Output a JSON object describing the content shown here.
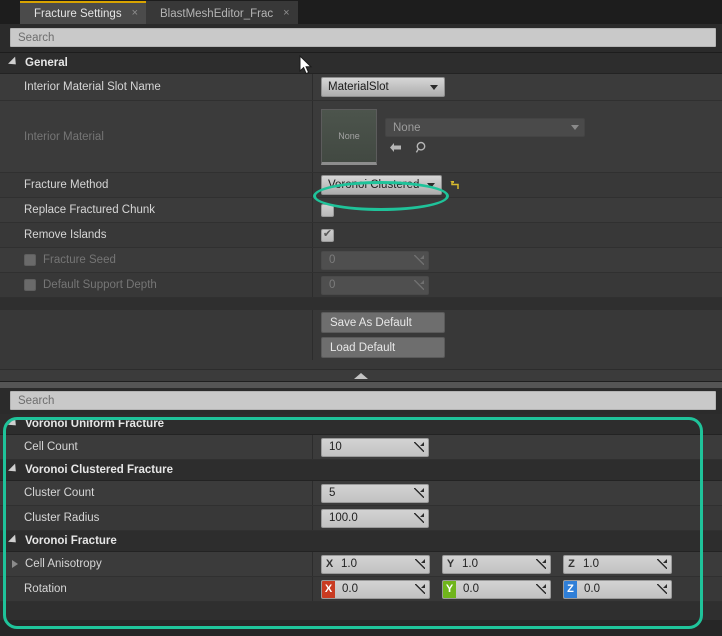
{
  "window": {
    "title": "Fracture Settings"
  },
  "tabs": [
    {
      "label": "Fracture Settings",
      "close": "×",
      "active": true
    },
    {
      "label": "BlastMeshEditor_Frac",
      "close": "×",
      "active": false
    }
  ],
  "search_top": {
    "placeholder": "Search",
    "value": ""
  },
  "search_bottom": {
    "placeholder": "Search",
    "value": ""
  },
  "general": {
    "header": "General",
    "interior_material_slot_name": {
      "label": "Interior Material Slot Name",
      "value": "MaterialSlot"
    },
    "interior_material": {
      "label": "Interior Material",
      "thumbnail_text": "None",
      "asset_value": "None",
      "browse_icon": "back-arrow-icon",
      "find_icon": "magnifier-icon"
    },
    "fracture_method": {
      "label": "Fracture Method",
      "value": "Voronoi Clustered",
      "reset_icon": "reset-arrow-icon"
    },
    "replace_fractured_chunk": {
      "label": "Replace Fractured Chunk",
      "checked": false
    },
    "remove_islands": {
      "label": "Remove Islands",
      "checked": true
    },
    "fracture_seed": {
      "label": "Fracture Seed",
      "value": "0",
      "enabled": false,
      "checked": false
    },
    "default_support_depth": {
      "label": "Default Support Depth",
      "value": "0",
      "enabled": false,
      "checked": false
    }
  },
  "buttons": {
    "save_as_default": "Save As Default",
    "load_default": "Load Default"
  },
  "voronoi_uniform": {
    "header": "Voronoi Uniform Fracture",
    "cell_count": {
      "label": "Cell Count",
      "value": "10"
    }
  },
  "voronoi_clustered": {
    "header": "Voronoi Clustered Fracture",
    "cluster_count": {
      "label": "Cluster Count",
      "value": "5"
    },
    "cluster_radius": {
      "label": "Cluster Radius",
      "value": "100.0"
    }
  },
  "voronoi_fracture": {
    "header": "Voronoi Fracture",
    "cell_anisotropy": {
      "label": "Cell Anisotropy",
      "expanded": false,
      "x": {
        "tag": "X",
        "value": "1.0"
      },
      "y": {
        "tag": "Y",
        "value": "1.0"
      },
      "z": {
        "tag": "Z",
        "value": "1.0"
      }
    },
    "rotation": {
      "label": "Rotation",
      "x": {
        "tag": "X",
        "value": "0.0"
      },
      "y": {
        "tag": "Y",
        "value": "0.0"
      },
      "z": {
        "tag": "Z",
        "value": "0.0"
      }
    }
  },
  "colors": {
    "highlight": "#1fc39a",
    "tab_accent": "#d8a300",
    "axis_x": "#c93b22",
    "axis_y": "#70b51c",
    "axis_z": "#2f7fd8"
  }
}
